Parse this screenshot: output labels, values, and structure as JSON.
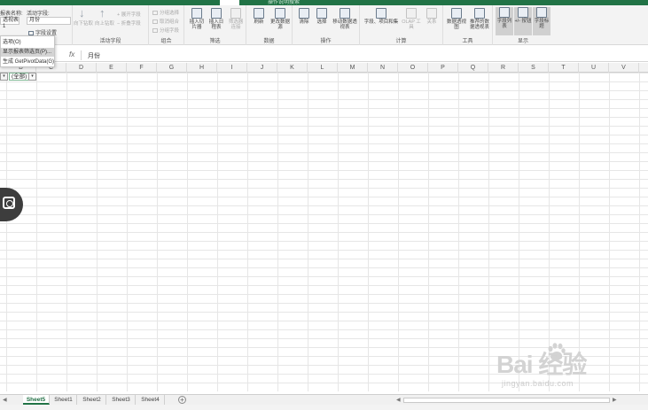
{
  "title_bar": {
    "tell_me": "操作说明搜索"
  },
  "ribbon": {
    "active_field": {
      "name_label": "报表名称:",
      "pivot_name": "透视表1",
      "field_label": "活动字段:",
      "field_value": "月份",
      "field_settings": "字段设置",
      "group_label": "活动字段"
    },
    "drill": {
      "down": "向下钻取",
      "up": "向上钻取",
      "expand": "展开字段",
      "collapse": "折叠字段"
    },
    "group": {
      "label": "组合",
      "items": [
        "分组选择",
        "取消组合",
        "分组字段"
      ]
    },
    "filter": {
      "label": "筛选",
      "buttons": [
        "插入切片器",
        "插入日程表",
        "筛选器连接"
      ]
    },
    "data": {
      "label": "数据",
      "buttons": [
        "刷新",
        "更改数据源"
      ]
    },
    "actions": {
      "label": "操作",
      "buttons": [
        "清除",
        "选择",
        "移动数据透视表"
      ]
    },
    "calculations": {
      "label": "计算",
      "buttons": [
        "字段、项目和集",
        "OLAP 工具",
        "关系"
      ]
    },
    "tools": {
      "label": "工具",
      "buttons": [
        "数据透视图",
        "推荐的数据透视表"
      ]
    },
    "show": {
      "label": "显示",
      "buttons": [
        "字段列表",
        "+/- 按钮",
        "字段标题"
      ]
    }
  },
  "options_menu": {
    "items": [
      "选项(O)",
      "显示报表筛选页(P)...",
      "生成 GetPivotData(G)"
    ]
  },
  "formula_bar": {
    "fx": "fx",
    "value": "月份"
  },
  "columns": [
    "B",
    "C",
    "D",
    "E",
    "F",
    "G",
    "H",
    "I",
    "J",
    "K",
    "L",
    "M",
    "N",
    "O",
    "P",
    "Q",
    "R",
    "S",
    "T",
    "U",
    "V"
  ],
  "filter_cell": {
    "value": "(全部)"
  },
  "sheets": [
    "Sheet5",
    "Sheet1",
    "Sheet2",
    "Sheet3",
    "Sheet4"
  ],
  "active_sheet": "Sheet5",
  "watermark": {
    "brand": "Bai 经验",
    "url": "jingyan.baidu.com"
  },
  "colors": {
    "accent": "#217346"
  }
}
